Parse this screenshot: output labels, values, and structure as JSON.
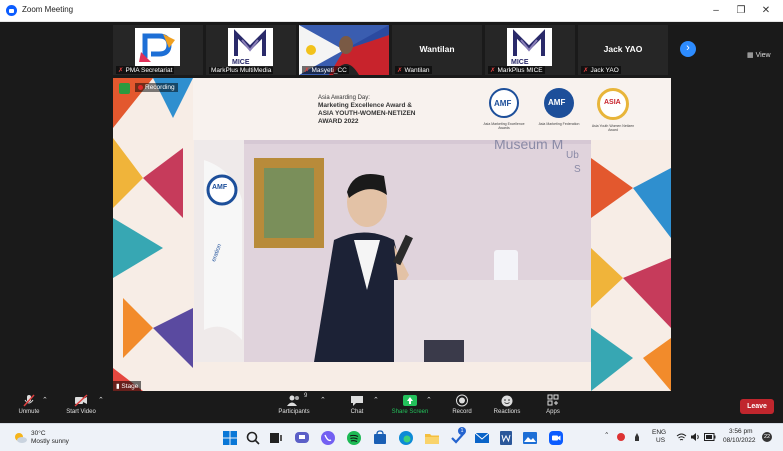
{
  "window": {
    "title": "Zoom Meeting",
    "minimize": "–",
    "maximize": "❐",
    "close": "✕"
  },
  "gallery": {
    "tiles": [
      {
        "name": "PMA Secretariat",
        "muted": true
      },
      {
        "name": "MarkPlus MultiMedia",
        "muted": false
      },
      {
        "name": "Masyeti_CC",
        "muted": true
      },
      {
        "name": "Wantilan",
        "muted": true,
        "big_name": "Wantilan"
      },
      {
        "name": "MarkPlus MICE",
        "muted": true
      },
      {
        "name": "Jack YAO",
        "muted": true,
        "big_name": "Jack YAO"
      }
    ],
    "mice_logo_text": "MICE",
    "next_icon": "›",
    "view_label": "View"
  },
  "stage": {
    "recording_label": "Recording",
    "stage_label": "Stage",
    "banner": {
      "line1": "Asia Awarding Day:",
      "line2": "Marketing Excellence Award &",
      "line3": "ASIA YOUTH-WOMEN-NETIZEN",
      "line4": "AWARD 2022",
      "logo_amf": "AMF",
      "logo_asia": "ASIA",
      "logo_amf_sub": "Asia Marketing Federation",
      "logo_arma_sub": "Asia Marketing Excellence Awards",
      "logo_award_sub": "Asia Youth Women Netizen Award"
    },
    "backdrop_text": "Museum M",
    "backdrop_sub1": "Ub",
    "backdrop_sub2": "S",
    "flag_text": "AMF",
    "flag_sub": "eration"
  },
  "toolbar": {
    "items": [
      {
        "label": "Unmute",
        "icon": "mic-muted-icon"
      },
      {
        "label": "Start Video",
        "icon": "video-off-icon"
      },
      {
        "label": "Participants",
        "icon": "participants-icon",
        "count": "9"
      },
      {
        "label": "Chat",
        "icon": "chat-icon"
      },
      {
        "label": "Share Screen",
        "icon": "share-screen-icon"
      },
      {
        "label": "Record",
        "icon": "record-icon"
      },
      {
        "label": "Reactions",
        "icon": "reactions-icon"
      },
      {
        "label": "Apps",
        "icon": "apps-icon"
      }
    ],
    "leave_label": "Leave",
    "colors": {
      "share": "#23c15b",
      "leave": "#c0262d"
    }
  },
  "taskbar": {
    "weather_temp": "30°C",
    "weather_condition": "Mostly sunny",
    "language": "ENG",
    "region": "US",
    "time": "3:56 pm",
    "date": "08/10/2022",
    "notification_count": "22",
    "mail_badge": "1"
  }
}
